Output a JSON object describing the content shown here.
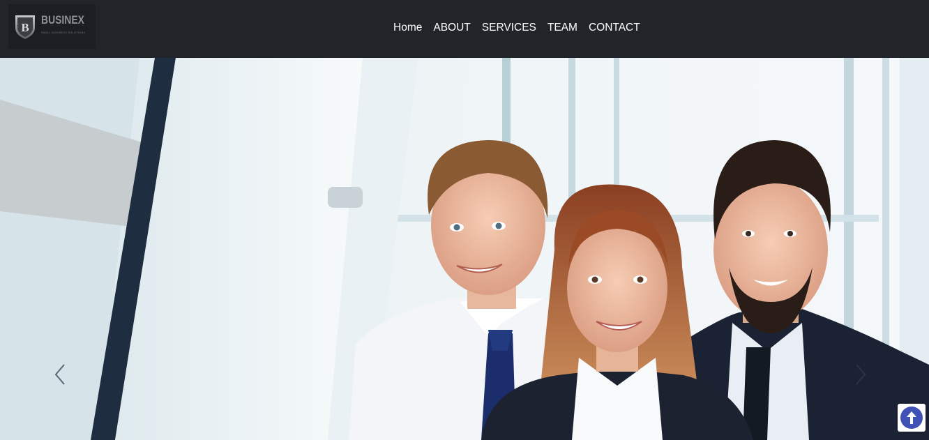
{
  "brand": {
    "name": "BUSINEX",
    "tagline": "SMALL BUSINESS SOLUTIONS",
    "logo_icon": "shield-b-icon",
    "logo_letter": "B"
  },
  "nav": {
    "items": [
      {
        "label": "Home"
      },
      {
        "label": "ABOUT"
      },
      {
        "label": "SERVICES"
      },
      {
        "label": "TEAM"
      },
      {
        "label": "CONTACT"
      }
    ]
  },
  "hero": {
    "image": "business-team-photo",
    "prev_icon": "chevron-left-icon",
    "next_icon": "chevron-right-icon"
  },
  "scroll_top": {
    "icon": "arrow-up-circle-icon"
  },
  "colors": {
    "topbar": "#212529",
    "nav_text": "#ffffff",
    "scroll_top_accent": "#3f51b5"
  }
}
